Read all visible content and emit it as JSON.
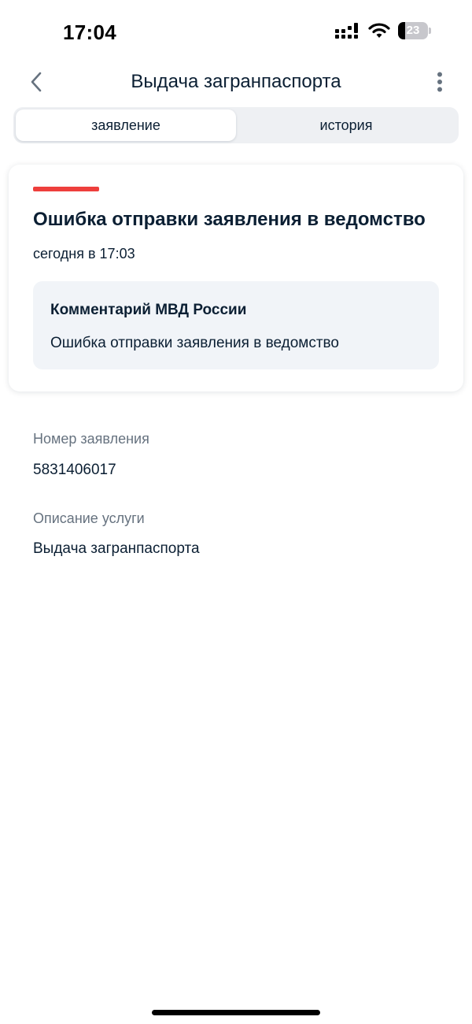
{
  "status_bar": {
    "time": "17:04",
    "battery": "23",
    "battery_level": 0.23,
    "icons": [
      "signal-icon",
      "wifi-icon",
      "battery-icon"
    ]
  },
  "header": {
    "title": "Выдача загранпаспорта",
    "back_icon": "chevron-left-icon",
    "more_icon": "vertical-dots-icon"
  },
  "tabs": [
    {
      "label": "заявление",
      "active": true
    },
    {
      "label": "история",
      "active": false
    }
  ],
  "status_card": {
    "indicator_color": "#ee3f3c",
    "title": "Ошибка отправки заявления в ведомство",
    "date": "сегодня в 17:03",
    "comment": {
      "title": "Комментарий МВД России",
      "text": "Ошибка отправки заявления в ведомство"
    }
  },
  "fields": [
    {
      "label": "Номер заявления",
      "value": "5831406017"
    },
    {
      "label": "Описание услуги",
      "value": "Выдача загранпаспорта"
    }
  ],
  "colors": {
    "text_primary": "#0b1f33",
    "text_secondary": "#66727f",
    "accent_error": "#ee3f3c",
    "tab_background": "#eef0f3",
    "comment_background": "#f1f4f8"
  }
}
